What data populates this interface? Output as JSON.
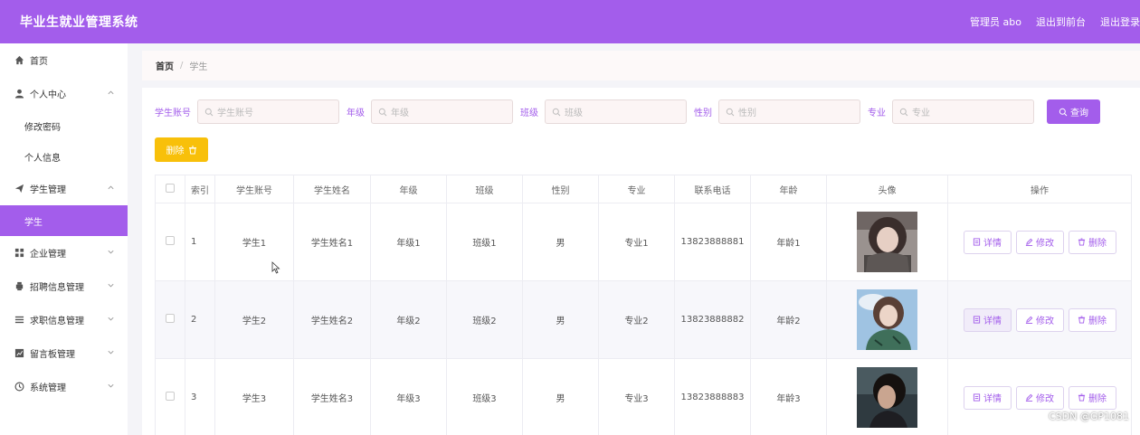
{
  "header": {
    "title": "毕业生就业管理系统",
    "user": "管理员 abo",
    "back_to_front": "退出到前台",
    "logout": "退出登录"
  },
  "sidebar": {
    "items": [
      {
        "label": "首页",
        "icon": "home-icon"
      },
      {
        "label": "个人中心",
        "icon": "user-icon",
        "expanded": true
      },
      {
        "label": "修改密码"
      },
      {
        "label": "个人信息"
      },
      {
        "label": "学生管理",
        "icon": "send-icon",
        "expanded": true
      },
      {
        "label": "学生",
        "active": true
      },
      {
        "label": "企业管理",
        "icon": "grid-icon"
      },
      {
        "label": "招聘信息管理",
        "icon": "printer-icon"
      },
      {
        "label": "求职信息管理",
        "icon": "list-icon"
      },
      {
        "label": "留言板管理",
        "icon": "chart-icon"
      },
      {
        "label": "系统管理",
        "icon": "clock-icon"
      }
    ]
  },
  "breadcrumb": {
    "home": "首页",
    "sep": "/",
    "current": "学生"
  },
  "search": {
    "fields": [
      {
        "label": "学生账号",
        "placeholder": "学生账号"
      },
      {
        "label": "年级",
        "placeholder": "年级"
      },
      {
        "label": "班级",
        "placeholder": "班级"
      },
      {
        "label": "性别",
        "placeholder": "性别"
      },
      {
        "label": "专业",
        "placeholder": "专业"
      }
    ],
    "query_label": "查询"
  },
  "toolbar": {
    "delete_label": "删除"
  },
  "table": {
    "columns": [
      "索引",
      "学生账号",
      "学生姓名",
      "年级",
      "班级",
      "性别",
      "专业",
      "联系电话",
      "年龄",
      "头像",
      "操作"
    ],
    "rows": [
      {
        "index": "1",
        "account": "学生1",
        "name": "学生姓名1",
        "grade": "年级1",
        "class": "班级1",
        "gender": "男",
        "major": "专业1",
        "phone": "13823888881",
        "age": "年龄1"
      },
      {
        "index": "2",
        "account": "学生2",
        "name": "学生姓名2",
        "grade": "年级2",
        "class": "班级2",
        "gender": "男",
        "major": "专业2",
        "phone": "13823888882",
        "age": "年龄2"
      },
      {
        "index": "3",
        "account": "学生3",
        "name": "学生姓名3",
        "grade": "年级3",
        "class": "班级3",
        "gender": "男",
        "major": "专业3",
        "phone": "13823888883",
        "age": "年龄3"
      }
    ],
    "ops": {
      "detail": "详情",
      "edit": "修改",
      "delete": "删除"
    }
  },
  "watermark": "CSDN @GP1081",
  "colors": {
    "accent": "#a35deb",
    "warning": "#f8c00a"
  }
}
